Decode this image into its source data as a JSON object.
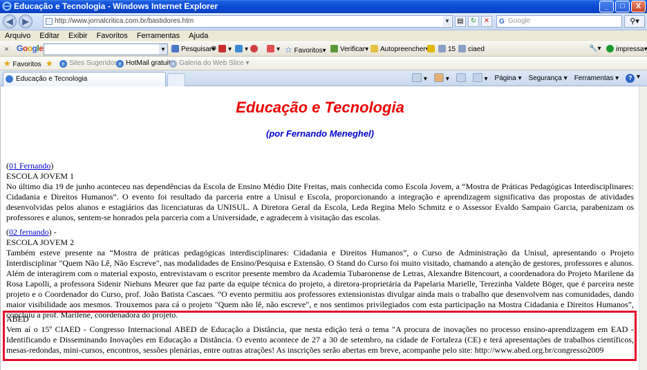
{
  "window": {
    "title": "Educação e Tecnologia - Windows Internet Explorer",
    "buttons": {
      "minimize": "_",
      "maximize": "□",
      "close": "X"
    }
  },
  "address": {
    "url": "http://www.jornalcritica.com.br/bastidores.htm",
    "search_placeholder": "Google"
  },
  "menu": [
    "Arquivo",
    "Editar",
    "Exibir",
    "Favoritos",
    "Ferramentas",
    "Ajuda"
  ],
  "google_toolbar": {
    "logo": "Google",
    "pesquisar": "Pesquisar",
    "favoritos": "Favoritos",
    "verificar": "Verificar",
    "autopreencher": "Autopreencher",
    "count": "15",
    "ciaed": "ciaed",
    "impressa": "impressa"
  },
  "favorites_bar": {
    "favoritos": "Favoritos",
    "sites": "Sites Sugeridos",
    "hotmail": "HotMail gratuito",
    "galeria": "Galeria do Web Slice"
  },
  "tab": {
    "label": "Educação e Tecnologia"
  },
  "commands": {
    "pagina": "Página",
    "seguranca": "Segurança",
    "ferramentas": "Ferramentas"
  },
  "page": {
    "title": "Educação e Tecnologia",
    "subtitle": "(por Fernando Meneghel)",
    "articles": [
      {
        "link": "01 Fernando",
        "suffix": ")",
        "heading": "ESCOLA JOVEM 1",
        "body": "No último dia 19 de junho aconteceu nas dependências da Escola de Ensino Médio Dite Freitas, mais conhecida como Escola Jovem, a “Mostra de Práticas Pedagógicas Interdisciplinares: Cidadania e Direitos Humanos”. O evento foi resultado da parceria entre a Unisul e Escola, proporcionando a integração e aprendizagem significativa das propostas de atividades desenvolvidas pelos alunos e estagiários das licenciaturas da UNISUL. A Diretora Geral da Escola, Leda Regina Melo Schmitz e o Assessor Evaldo Sampaio Garcia, parabenizam os professores e alunos, sentem-se honrados pela parceria com a Universidade, e agradecem à visitação das escolas."
      },
      {
        "link": "02 fernando",
        "suffix": ") -",
        "heading": "ESCOLA JOVEM 2",
        "body": "Também esteve presente na “Mostra de práticas pedagógicas interdisciplinares: Cidadania e Direitos Humanos”, o Curso de Administração da Unisul, apresentando o Projeto Interdisciplinar \"Quem Não Lê, Não Escreve\", nas modalidades de Ensino/Pesquisa e Extensão. O Stand do Curso foi muito visitado, chamando a atenção de gestores, professores e alunos. Além de interagirem com o material exposto, entrevistavam o escritor presente membro da Academia Tubaronense de Letras, Alexandre Bitencourt, a coordenadora do Projeto Marilene da Rosa Lapolli, a professora Sidenir Niehuns Meurer que faz parte da equipe técnica do projeto, a diretora-proprietária da Papelaria Marielle, Terezinha Valdete Böger, que é parceira neste projeto e o Coordenador do Curso, prof. João Batista Cascaes. “O evento permitiu aos professores extensionistas divulgar ainda mais o trabalho que desenvolvem nas comunidades, dando maior visibilidade aos mesmos. Trouxemos para cá o projeto \"Quem não lê, não escreve\", e nos sentimos privilegiados com esta participação na Mostra Cidadania e Direitos Humanos”, concluiu a prof. Marilene, coordenadora do projeto."
      },
      {
        "heading": "ABED",
        "body": "Vem aí o 15º CIAED - Congresso Internacional ABED de Educação a Distância, que nesta edição terá o tema \"A procura de inovações no processo ensino-aprendizagem em EAD -Identificando e Disseminando Inovações em Educação a Distância. O evento acontece de 27 a 30 de setembro, na cidade de Fortaleza (CE) e terá apresentações de trabalhos científicos, mesas-redondas, mini-cursos, encontros, sessões plenárias, entre outras atrações! As inscrições serão abertas em breve, acompanhe pelo site: http://www.abed.org.br/congresso2009"
      }
    ]
  }
}
